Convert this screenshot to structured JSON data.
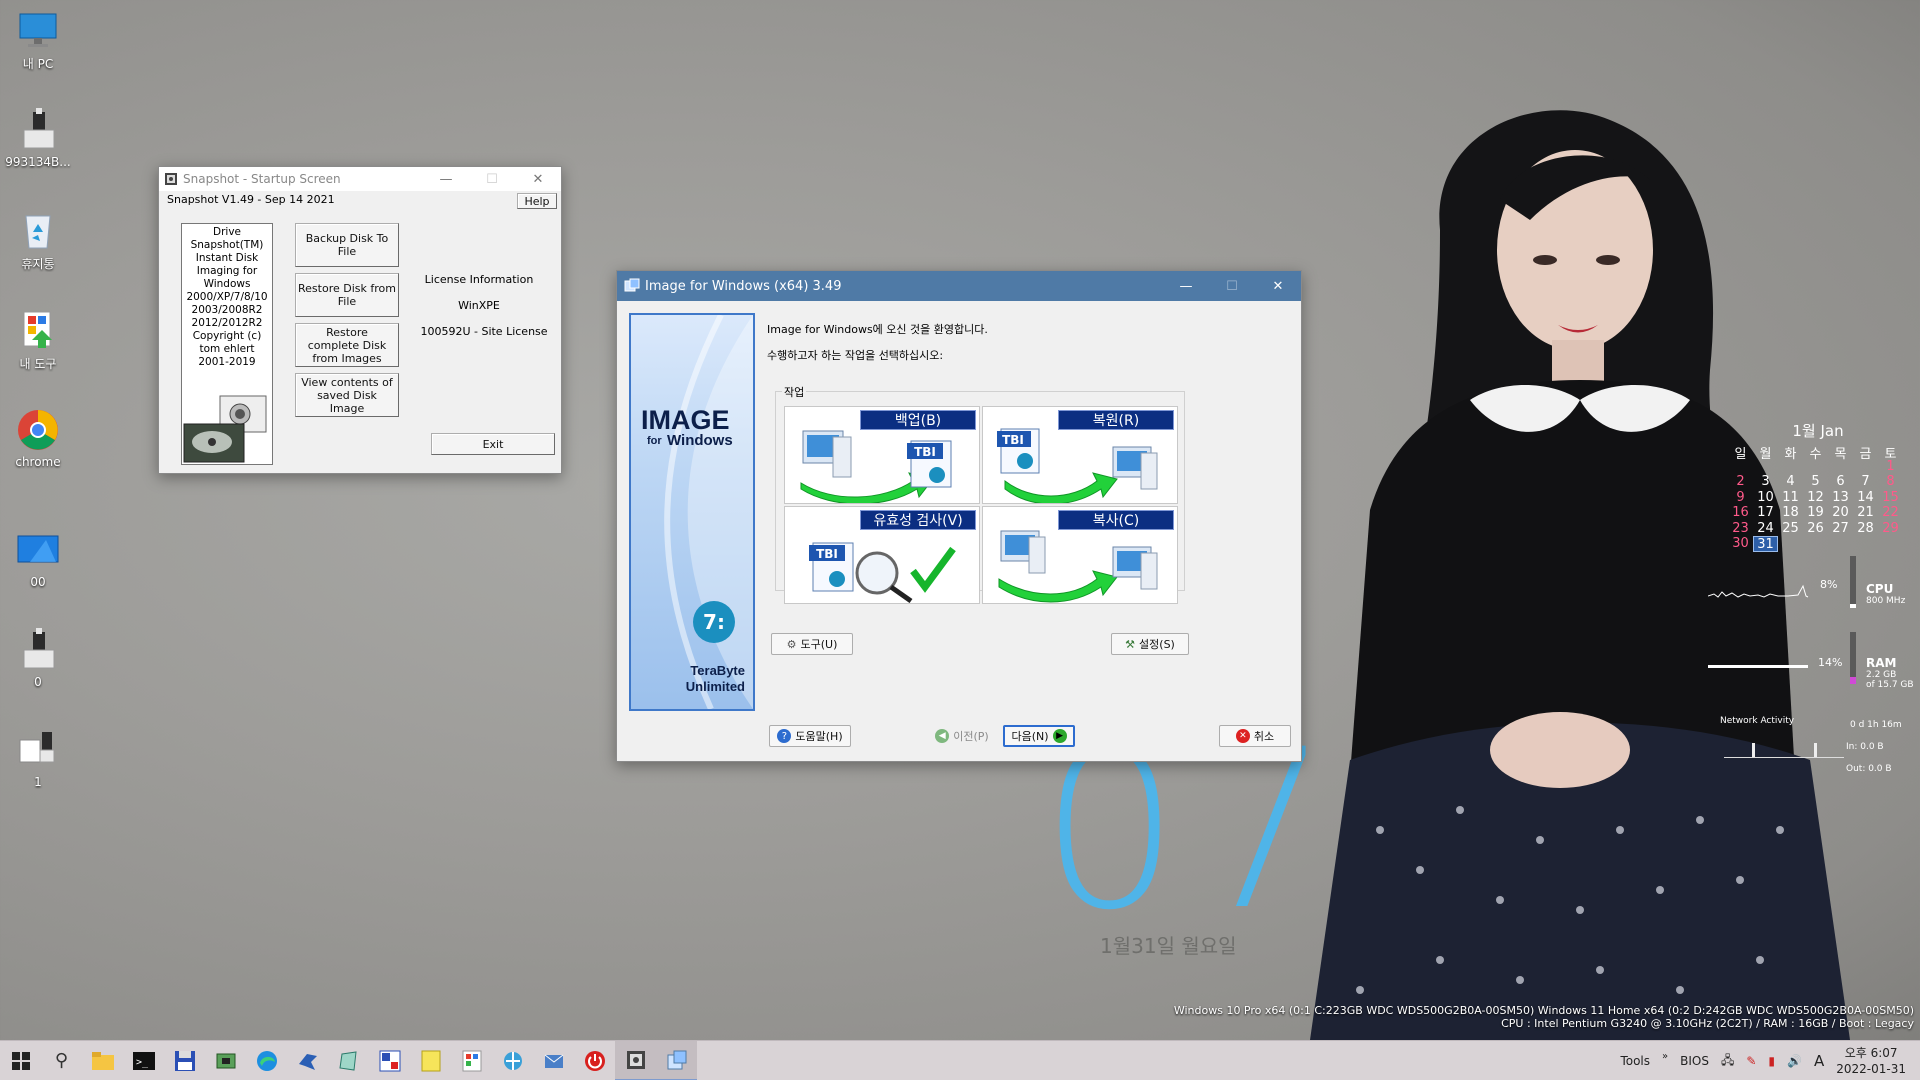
{
  "desktop": {
    "icons": [
      {
        "label": "내 PC"
      },
      {
        "label": "993134B..."
      },
      {
        "label": "휴지통"
      },
      {
        "label": "내 도구"
      },
      {
        "label": "chrome"
      },
      {
        "label": "00"
      },
      {
        "label": "0"
      },
      {
        "label": "1"
      }
    ],
    "clock_big": "07",
    "date_big": "1월31일  월요일",
    "sysinfo_line1": "Windows 10 Pro x64 (0:1 C:223GB WDC  WDS500G2B0A-00SM50) Windows 11 Home x64 (0:2 D:242GB WDC  WDS500G2B0A-00SM50)",
    "sysinfo_line2": "CPU : Intel Pentium G3240 @ 3.10GHz (2C2T) / RAM : 16GB / Boot : Legacy"
  },
  "calendar": {
    "month": "1월 Jan",
    "weekdays": [
      "일",
      "월",
      "화",
      "수",
      "목",
      "금",
      "토"
    ],
    "weeks": [
      [
        "",
        "",
        "",
        "",
        "",
        "",
        "1"
      ],
      [
        "2",
        "3",
        "4",
        "5",
        "6",
        "7",
        "8"
      ],
      [
        "9",
        "10",
        "11",
        "12",
        "13",
        "14",
        "15"
      ],
      [
        "16",
        "17",
        "18",
        "19",
        "20",
        "21",
        "22"
      ],
      [
        "23",
        "24",
        "25",
        "26",
        "27",
        "28",
        "29"
      ],
      [
        "30",
        "31",
        "",
        "",
        "",
        "",
        ""
      ]
    ],
    "today": "31"
  },
  "meters": {
    "cpu_pct": "8%",
    "cpu_label": "CPU",
    "cpu_sub": "800 MHz",
    "cpu_level": 0.08,
    "ram_pct": "14%",
    "ram_label": "RAM",
    "ram_sub1": "2.2 GB",
    "ram_sub2": "of 15.7 GB",
    "ram_level": 0.14,
    "net_title": "Network Activity",
    "net_uptime": "0 d 1h 16m",
    "net_in": "In: 0.0 B",
    "net_out": "Out: 0.0 B"
  },
  "snapshot": {
    "title": "Snapshot - Startup Screen",
    "version": "Snapshot V1.49 - Sep 14 2021",
    "help": "Help",
    "about": [
      "Drive",
      "Snapshot(TM)",
      "Instant Disk",
      "Imaging for",
      "Windows",
      "2000/XP/7/8/10",
      "2003/2008R2",
      "2012/2012R2",
      "Copyright (c)",
      "tom ehlert",
      "2001-2019"
    ],
    "buttons": {
      "backup": "Backup Disk To File",
      "restore": "Restore Disk from File",
      "restore_images": "Restore complete Disk from Images",
      "view": "View contents of saved Disk Image",
      "exit": "Exit"
    },
    "license_title": "License Information",
    "license_env": "WinXPE",
    "license_id": "100592U - Site License"
  },
  "ifw": {
    "title": "Image for Windows (x64) 3.49",
    "logo_main": "IMAGE",
    "logo_for": "for",
    "logo_windows": "Windows",
    "logo_company1": "TeraByte",
    "logo_company2": "Unlimited",
    "welcome": "Image for Windows에 오신 것을 환영합니다.",
    "instruction": "수행하고자 하는 작업을 선택하십시오:",
    "group_label": "작업",
    "tiles": {
      "backup": "백업(B)",
      "restore": "복원(R)",
      "validate": "유효성 검사(V)",
      "copy": "복사(C)"
    },
    "tbi": "TBI",
    "tools": "도구(U)",
    "settings": "설정(S)",
    "help": "도움말(H)",
    "prev": "이전(P)",
    "next": "다음(N)",
    "cancel": "취소"
  },
  "taskbar": {
    "tools": "Tools",
    "bios": "BIOS",
    "ime": "A",
    "time": "오후 6:07",
    "date": "2022-01-31"
  },
  "colors": {
    "ifw_titlebar": "#4f7aa6",
    "tile_tag": "#0b2e82",
    "clock": "#4fb4e8",
    "weekend": "#ff5a8a"
  }
}
